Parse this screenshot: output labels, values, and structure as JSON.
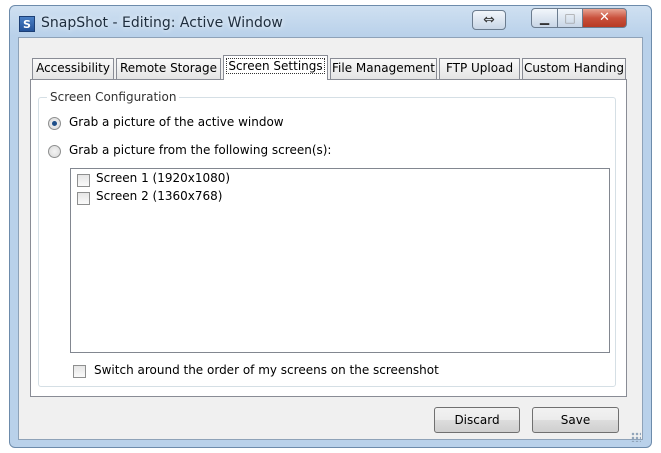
{
  "window": {
    "title": "SnapShot - Editing: Active Window",
    "app_icon_letter": "S",
    "controls": {
      "swap": "⇔",
      "minimize": "▁",
      "maximize": "□",
      "close": "✕"
    }
  },
  "tabs": [
    {
      "label": "Accessibility"
    },
    {
      "label": "Remote Storage"
    },
    {
      "label": "Screen Settings",
      "active": true
    },
    {
      "label": "File Management"
    },
    {
      "label": "FTP Upload"
    },
    {
      "label": "Custom Handing"
    }
  ],
  "screen_config": {
    "group_title": "Screen Configuration",
    "option_active": "Grab a picture of the active window",
    "option_screens": "Grab a picture from the following screen(s):",
    "selected_option": "active_window",
    "screens": [
      {
        "label": "Screen 1 (1920x1080)",
        "checked": false
      },
      {
        "label": "Screen 2 (1360x768)",
        "checked": false
      }
    ],
    "switch_order_label": "Switch around the order of my screens on the screenshot",
    "switch_order_checked": false
  },
  "buttons": {
    "discard": "Discard",
    "save": "Save"
  },
  "colors": {
    "titlebar": "#b9d1ea",
    "close_button": "#c9503b",
    "radio_dot": "#1d4e89"
  }
}
